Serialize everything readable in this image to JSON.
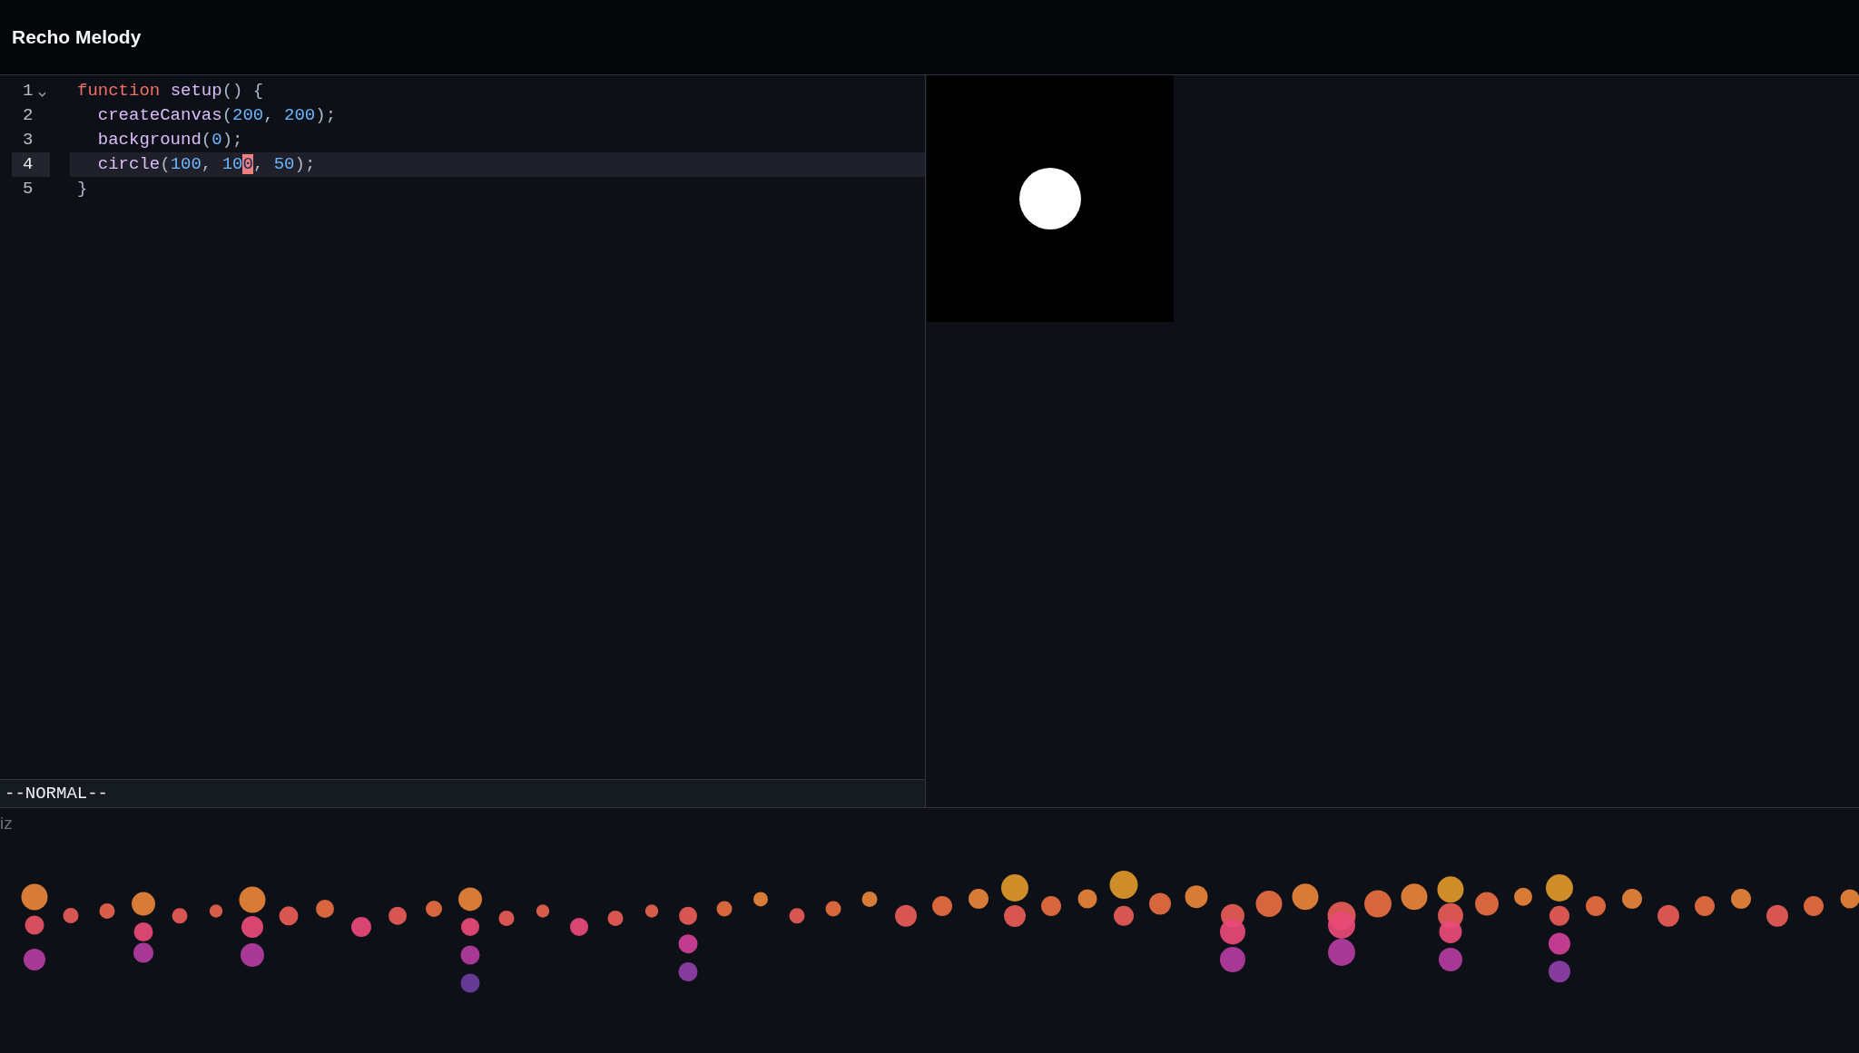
{
  "header": {
    "title": "Recho Melody"
  },
  "editor": {
    "lines": [
      {
        "number": "1",
        "foldable": true,
        "active": false,
        "tokens": [
          {
            "kind": "keyword",
            "text": "function "
          },
          {
            "kind": "function",
            "text": "setup"
          },
          {
            "kind": "punct",
            "text": "() {"
          }
        ],
        "children": [
          {
            "number": "2",
            "foldable": false,
            "active": false,
            "tokens": [
              {
                "kind": "function",
                "text": "createCanvas"
              },
              {
                "kind": "punct",
                "text": "("
              },
              {
                "kind": "number",
                "text": "200"
              },
              {
                "kind": "punct",
                "text": ", "
              },
              {
                "kind": "number",
                "text": "200"
              },
              {
                "kind": "punct",
                "text": ");"
              }
            ]
          },
          {
            "number": "3",
            "foldable": false,
            "active": false,
            "tokens": [
              {
                "kind": "function",
                "text": "background"
              },
              {
                "kind": "punct",
                "text": "("
              },
              {
                "kind": "number",
                "text": "0"
              },
              {
                "kind": "punct",
                "text": ");"
              }
            ]
          },
          {
            "number": "4",
            "foldable": false,
            "active": true,
            "tokens": [
              {
                "kind": "function",
                "text": "circle"
              },
              {
                "kind": "punct",
                "text": "("
              },
              {
                "kind": "number",
                "text": "100"
              },
              {
                "kind": "punct",
                "text": ", "
              },
              {
                "kind": "number",
                "text": "10"
              },
              {
                "kind": "cursor",
                "text": "0"
              },
              {
                "kind": "punct",
                "text": ", "
              },
              {
                "kind": "number",
                "text": "50"
              },
              {
                "kind": "punct",
                "text": ");"
              }
            ]
          }
        ]
      },
      {
        "number": "5",
        "foldable": false,
        "active": false,
        "tokens": [
          {
            "kind": "punct",
            "text": "}"
          }
        ]
      }
    ]
  },
  "status_bar": {
    "mode": "--NORMAL--"
  },
  "viz_panel": {
    "label": "iz"
  }
}
